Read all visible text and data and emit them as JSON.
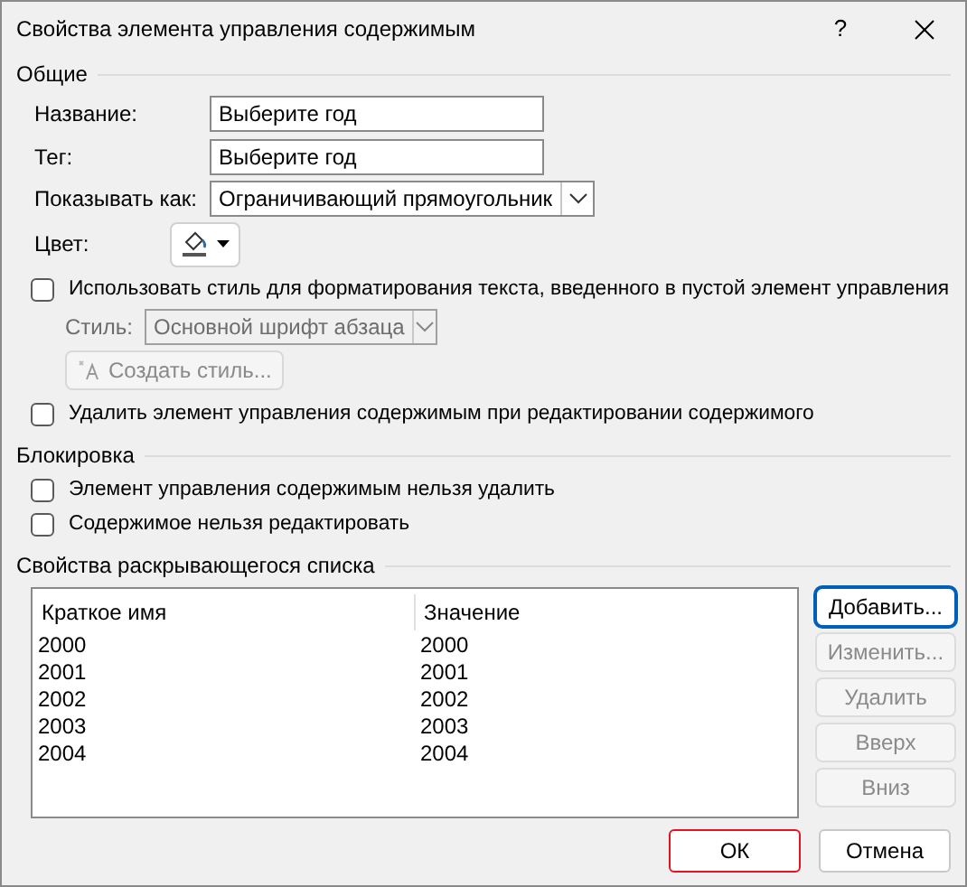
{
  "window": {
    "title": "Свойства элемента управления содержимым",
    "help": "?"
  },
  "general": {
    "heading": "Общие",
    "fields": [
      {
        "label": "Название:",
        "value": "Выберите год"
      },
      {
        "label": "Тег:",
        "value": "Выберите год"
      }
    ],
    "show_as": {
      "label": "Показывать как:",
      "value": "Ограничивающий прямоугольник"
    },
    "color": {
      "label": "Цвет:"
    },
    "use_style": {
      "label": "Использовать стиль для форматирования текста, введенного в пустой элемент управления",
      "checked": false
    },
    "style": {
      "label": "Стиль:",
      "value": "Основной шрифт абзаца",
      "disabled": true
    },
    "new_style_button": {
      "label": "Создать стиль...",
      "disabled": true
    },
    "remove_when_edited": {
      "label": "Удалить элемент управления содержимым при редактировании содержимого",
      "checked": false
    }
  },
  "locking": {
    "heading": "Блокировка",
    "options": [
      {
        "label": "Элемент управления содержимым нельзя удалить",
        "checked": false
      },
      {
        "label": "Содержимое нельзя редактировать",
        "checked": false
      }
    ]
  },
  "dropdown_list": {
    "heading": "Свойства раскрывающегося списка",
    "columns": [
      "Краткое имя",
      "Значение"
    ],
    "rows": [
      [
        "2000",
        "2000"
      ],
      [
        "2001",
        "2001"
      ],
      [
        "2002",
        "2002"
      ],
      [
        "2003",
        "2003"
      ],
      [
        "2004",
        "2004"
      ]
    ],
    "buttons": [
      {
        "label": "Добавить...",
        "disabled": false,
        "focused": true
      },
      {
        "label": "Изменить...",
        "disabled": true,
        "focused": false
      },
      {
        "label": "Удалить",
        "disabled": true,
        "focused": false
      },
      {
        "label": "Вверх",
        "disabled": true,
        "focused": false
      },
      {
        "label": "Вниз",
        "disabled": true,
        "focused": false
      }
    ]
  },
  "footer_buttons": [
    {
      "label": "ОК",
      "highlighted": true
    },
    {
      "label": "Отмена",
      "highlighted": false
    }
  ]
}
